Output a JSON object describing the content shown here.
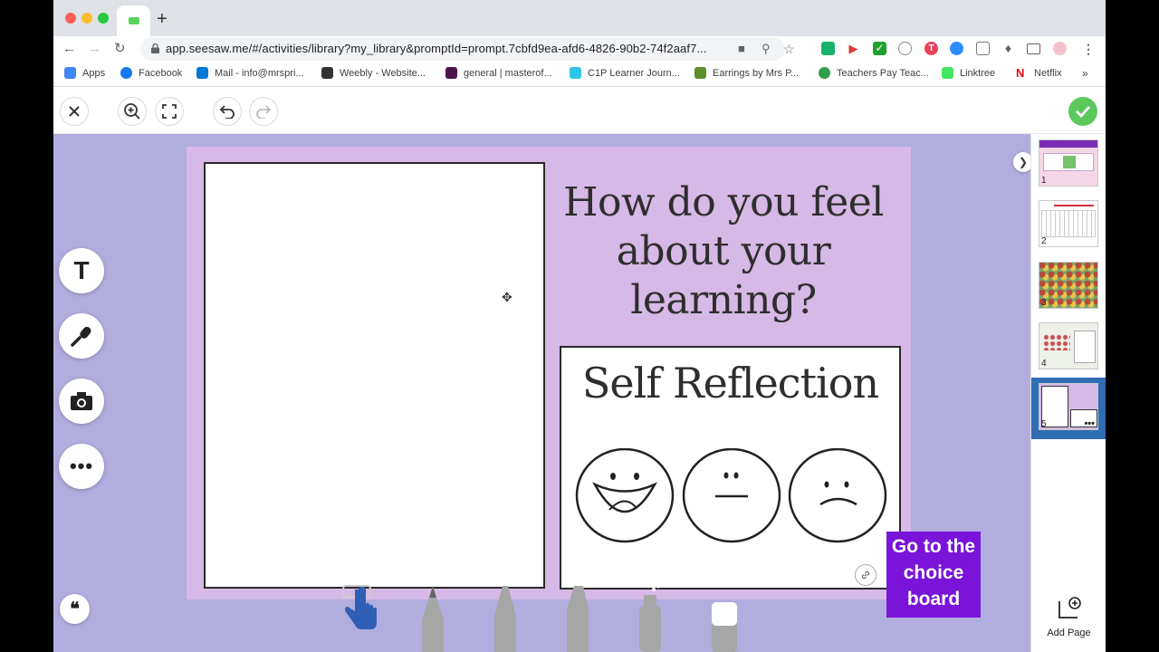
{
  "browser": {
    "url": "app.seesaw.me/#/activities/library?my_library&promptId=prompt.7cbfd9ea-afd6-4826-90b2-74f2aaf7...",
    "new_tab": "+",
    "bookmarks": [
      {
        "label": "Apps",
        "color": "#4285f4"
      },
      {
        "label": "Facebook",
        "color": "#1877f2"
      },
      {
        "label": "Mail - info@mrspri...",
        "color": "#0078d4"
      },
      {
        "label": "Weebly - Website...",
        "color": "#333333"
      },
      {
        "label": "general | masterof...",
        "color": "#4a154b"
      },
      {
        "label": "C1P Learner Journ...",
        "color": "#2ec4e8"
      },
      {
        "label": "Earrings by Mrs P...",
        "color": "#5a8f2b"
      },
      {
        "label": "Teachers Pay Teac...",
        "color": "#2e9f4a"
      },
      {
        "label": "Linktree",
        "color": "#43e660"
      },
      {
        "label": "Netflix",
        "color": "#e50914"
      }
    ],
    "more": "»"
  },
  "activity": {
    "question": "How do you feel about your learning?",
    "reflection_title": "Self Reflection",
    "choice_button": "Go to the choice board"
  },
  "tools": [
    "text-tool",
    "mic-tool",
    "camera-tool",
    "more-tool"
  ],
  "pages": [
    {
      "num": "1"
    },
    {
      "num": "2"
    },
    {
      "num": "3"
    },
    {
      "num": "4"
    },
    {
      "num": "5",
      "more": "•••"
    }
  ],
  "add_page": "Add Page",
  "colors": {
    "canvas": "#b2addf",
    "page": "#d6b9e6",
    "choice": "#7a14d8",
    "check": "#5cc85c",
    "active_page": "#2f6db5"
  }
}
